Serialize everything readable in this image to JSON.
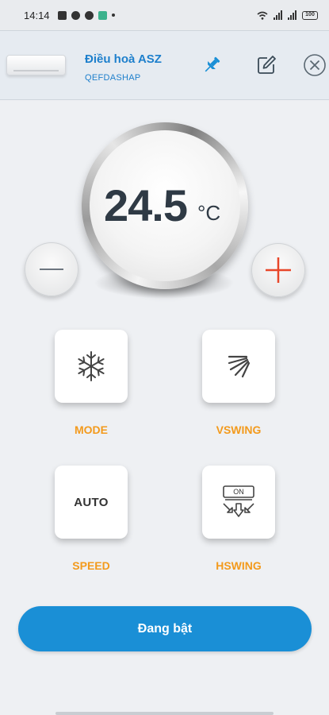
{
  "status_bar": {
    "time": "14:14",
    "battery": "100"
  },
  "header": {
    "device_name": "Điều hoà ASZ",
    "device_code": "QEFDASHAP",
    "icons": [
      "pin-icon",
      "edit-icon",
      "close-icon"
    ]
  },
  "thermostat": {
    "temperature": "24.5",
    "unit": "°C"
  },
  "controls": {
    "mode": {
      "label": "MODE",
      "icon": "snowflake-icon"
    },
    "vswing": {
      "label": "VSWING",
      "icon": "vertical-swing-icon"
    },
    "speed": {
      "label": "SPEED",
      "value": "AUTO"
    },
    "hswing": {
      "label": "HSWING",
      "icon": "horizontal-swing-icon",
      "badge": "ON"
    }
  },
  "power": {
    "label": "Đang bật"
  },
  "colors": {
    "accent_blue": "#1a8fd6",
    "label_orange": "#f39a1c",
    "plus_red": "#e8472a",
    "header_text": "#1d7fcc"
  }
}
